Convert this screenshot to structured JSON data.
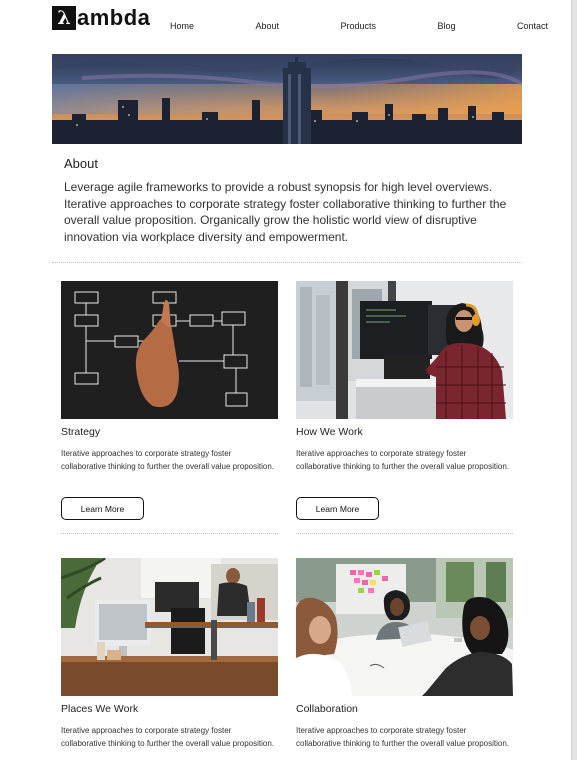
{
  "brand": {
    "logo_mark": "λ",
    "logo_text": "ambda"
  },
  "nav": [
    "Home",
    "About",
    "Products",
    "Blog",
    "Contact"
  ],
  "about": {
    "title": "About",
    "body": "Leverage agile frameworks to provide a robust synopsis for high level overviews. Iterative approaches to corporate strategy foster collaborative thinking to further the overall value proposition. Organically grow the holistic world view of disruptive innovation via workplace diversity and empowerment."
  },
  "cards": [
    {
      "title": "Strategy",
      "body": "Iterative approaches to corporate strategy foster collaborative thinking to further the overall value proposition.",
      "button": "Learn More"
    },
    {
      "title": "How We Work",
      "body": "Iterative approaches to corporate strategy foster collaborative thinking to further the overall value proposition.",
      "button": "Learn More"
    },
    {
      "title": "Places We Work",
      "body": "Iterative approaches to corporate strategy foster collaborative thinking to further the overall value proposition."
    },
    {
      "title": "Collaboration",
      "body": "Iterative approaches to corporate strategy foster collaborative thinking to further the overall value proposition."
    }
  ]
}
